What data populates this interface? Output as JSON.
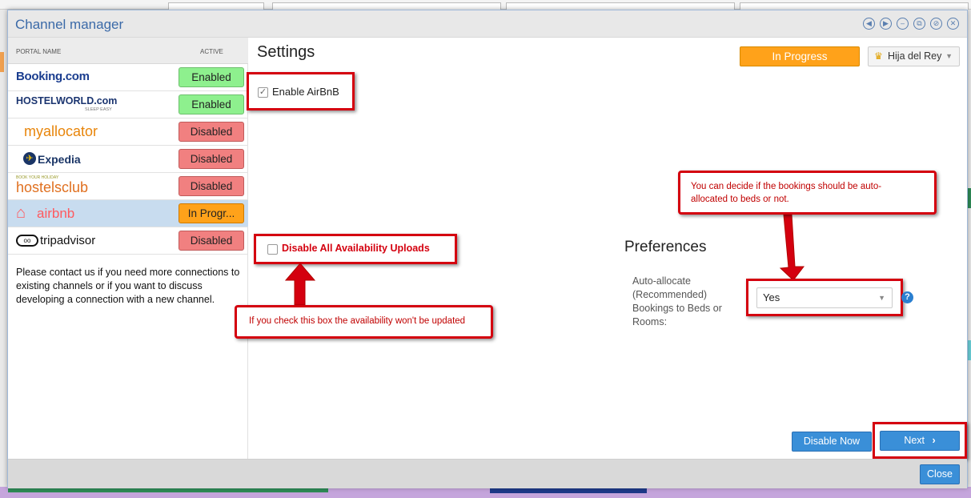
{
  "window": {
    "title": "Channel manager"
  },
  "table": {
    "col_portal": "PORTAL NAME",
    "col_active": "ACTIVE",
    "rows": [
      {
        "name": "Booking.com",
        "status": "Enabled",
        "state": "enabled"
      },
      {
        "name": "HOSTELWORLD.com",
        "sub": "SLEEP EASY",
        "status": "Enabled",
        "state": "enabled"
      },
      {
        "name": "myallocator",
        "status": "Disabled",
        "state": "disabled"
      },
      {
        "name": "Expedia",
        "status": "Disabled",
        "state": "disabled"
      },
      {
        "name": "hostelsclub",
        "sub": "BOOK YOUR HOLIDAY",
        "status": "Disabled",
        "state": "disabled"
      },
      {
        "name": "airbnb",
        "status": "In Progr...",
        "state": "progress",
        "selected": true
      },
      {
        "name": "tripadvisor",
        "status": "Disabled",
        "state": "disabled"
      }
    ],
    "contact_text": "Please contact us if you need more connections to existing channels or if you want to discuss developing a connection with a new channel."
  },
  "settings": {
    "heading": "Settings",
    "status_button": "In Progress",
    "property_name": "Hija del Rey",
    "enable_label": "Enable AirBnB",
    "enable_checked": true,
    "disable_uploads_label": "Disable All Availability Uploads",
    "disable_uploads_checked": false
  },
  "callouts": {
    "uploads": "If you check this box the availability won't be updated",
    "allocate": "You can decide if the bookings should be auto-allocated to beds or not."
  },
  "preferences": {
    "heading": "Preferences",
    "auto_allocate_label": "Auto-allocate (Recommended) Bookings to Beds or Rooms:",
    "auto_allocate_value": "Yes"
  },
  "buttons": {
    "disable_now": "Disable Now",
    "next": "Next",
    "close": "Close"
  },
  "colors": {
    "enabled": "#8ef08e",
    "disabled": "#f18080",
    "in_progress": "#ffa21a",
    "primary": "#3a8fd8",
    "annotation_red": "#d4000f"
  }
}
